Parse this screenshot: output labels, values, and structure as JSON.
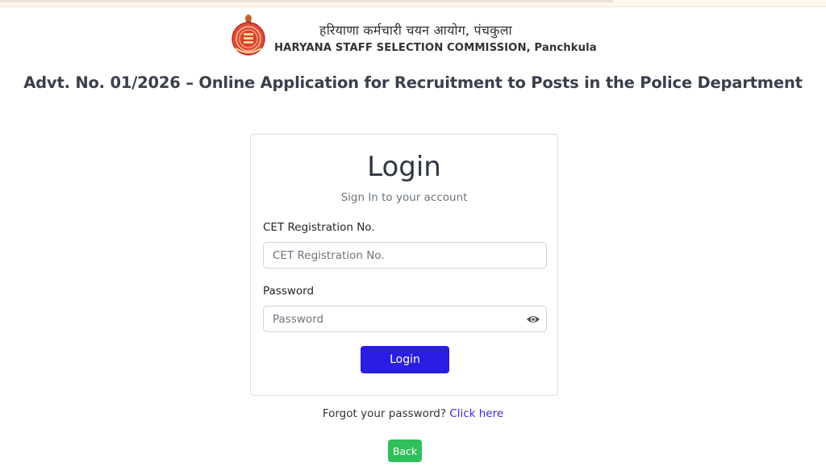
{
  "header": {
    "hindi_title": "हरियाणा कर्मचारी चयन आयोग, पंचकुला",
    "english_title": "HARYANA STAFF SELECTION COMMISSION, Panchkula",
    "emblem_icon": "haryana-state-emblem-icon"
  },
  "advertisement": {
    "title": "Advt. No. 01/2026 – Online Application for Recruitment to Posts in the Police Department"
  },
  "login_card": {
    "title": "Login",
    "subtitle": "Sign In to your account",
    "registration_label": "CET Registration No.",
    "registration_placeholder": "CET Registration No.",
    "registration_value": "",
    "password_label": "Password",
    "password_placeholder": "Password",
    "password_value": "",
    "password_toggle_icon": "eye-icon",
    "login_button": "Login"
  },
  "footer": {
    "forgot_text": "Forgot your password?",
    "forgot_link": "Click here",
    "back_button": "Back"
  },
  "colors": {
    "primary_button": "#2a1ee2",
    "back_button": "#2fbf5b",
    "link": "#3a2ad6",
    "heading": "#3a3f4b"
  }
}
